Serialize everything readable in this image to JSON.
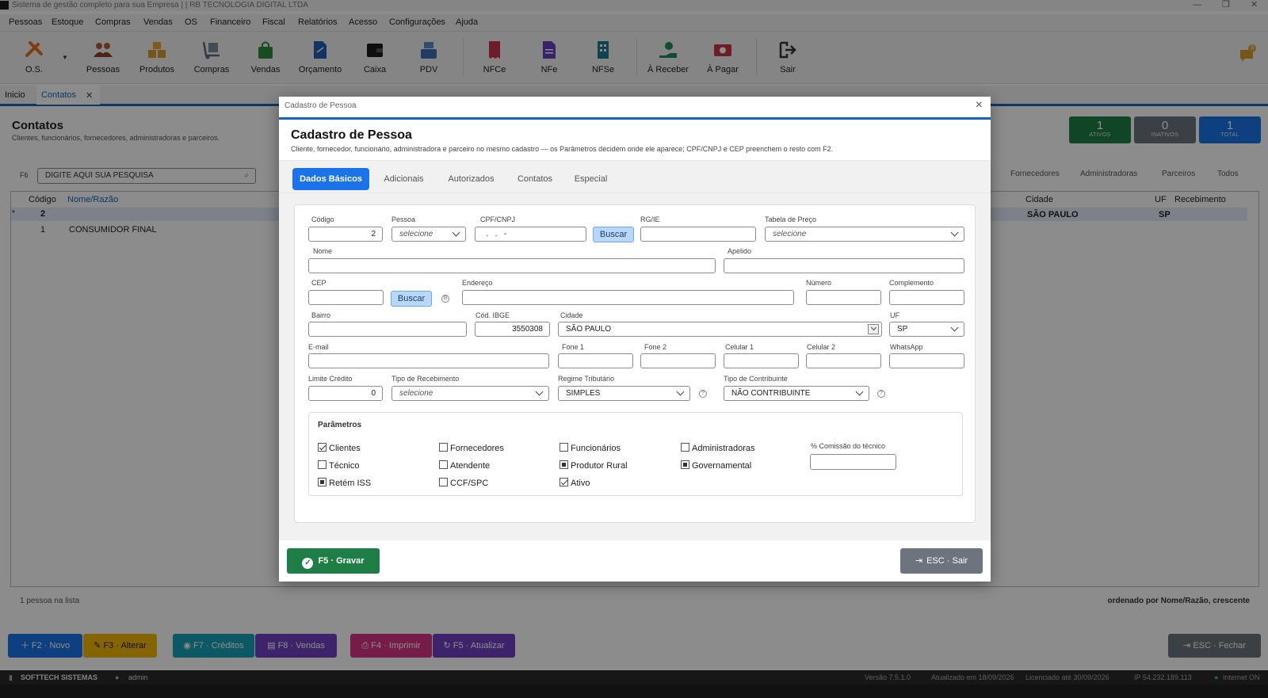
{
  "window": {
    "title": "Sistema de gestão completo para sua Empresa | | RB TECNOLOGIA DIGITAL LTDA"
  },
  "menu": [
    "Pessoas",
    "Estoque",
    "Compras",
    "Vendas",
    "OS",
    "Financeiro",
    "Fiscal",
    "Relatórios",
    "Acesso",
    "Configurações",
    "Ajuda"
  ],
  "toolbar": {
    "os": "O.S.",
    "pessoas": "Pessoas",
    "produtos": "Produtos",
    "compras": "Compras",
    "vendas": "Vendas",
    "orcamento": "Orçamento",
    "caixa": "Caixa",
    "pdv": "PDV",
    "nfce": "NFCe",
    "nfe": "NFe",
    "nfse": "NFSe",
    "areceber": "À Receber",
    "apagar": "À Pagar",
    "sair": "Sair",
    "notif_count": "3"
  },
  "tabs": {
    "inicio": "Inicio",
    "contatos": "Contatos"
  },
  "page": {
    "title": "Contatos",
    "subtitle": "Clientes, funcionários, fornecedores, administradoras e parceiros.",
    "search_key": "F6",
    "search_placeholder": "DIGITE AQUI SUA PESQUISA",
    "stats": [
      {
        "n": "1",
        "l": "ATIVOS"
      },
      {
        "n": "0",
        "l": "INATIVOS"
      },
      {
        "n": "1",
        "l": "TOTAL"
      }
    ],
    "filters": [
      "Fornecedores",
      "Administradoras",
      "Parceiros",
      "Todos"
    ],
    "columns": {
      "codigo": "Código",
      "nome": "Nome/Razão",
      "cidade": "Cidade",
      "uf": "UF",
      "recebimento": "Recebimento"
    },
    "rows": [
      {
        "marker": "*",
        "codigo": "2",
        "nome": "",
        "cidade": "SÃO PAULO",
        "uf": "SP"
      },
      {
        "marker": "",
        "codigo": "1",
        "nome": "CONSUMIDOR FINAL",
        "cidade": "",
        "uf": ""
      }
    ],
    "count": "1 pessoa na lista",
    "order": "ordenado por Nome/Razão, crescente"
  },
  "footer_buttons": {
    "novo": "F2 · Novo",
    "alterar": "F3 · Alterar",
    "creditos": "F7 · Créditos",
    "vendas": "F8 · Vendas",
    "imprimir": "F4 · Imprimir",
    "atualizar": "F5 · Atualizar",
    "fechar": "ESC · Fechar"
  },
  "statusbar": {
    "company": "SOFTTECH SISTEMAS",
    "user": "admin",
    "versao": "Versão  7.5.1.0",
    "atualizado": "Atualizado em 18/09/2026",
    "licenciado": "Licenciado até  30/09/2026",
    "ip": "IP  54.232.189.113",
    "internet": "Internet ON"
  },
  "modal": {
    "window_title": "Cadastro de Pessoa",
    "title": "Cadastro de Pessoa",
    "subtitle": "Cliente, fornecedor, funcionário, administradora e parceiro no mesmo cadastro — os Parâmetros decidem onde ele aparece; CPF/CNPJ e CEP preenchem o resto com F2.",
    "tabs": [
      "Dados Básicos",
      "Adicionais",
      "Autorizados",
      "Contatos",
      "Especial"
    ],
    "fields": {
      "codigo": {
        "label": "Código",
        "value": "2"
      },
      "pessoa": {
        "label": "Pessoa",
        "value": "selecione"
      },
      "cpf": {
        "label": "CPF/CNPJ",
        "value": "  .   .   -"
      },
      "buscar": "Buscar",
      "rg": {
        "label": "RG/IE",
        "value": ""
      },
      "tabela": {
        "label": "Tabela de Preço",
        "value": "selecione"
      },
      "nome": {
        "label": "Nome",
        "value": ""
      },
      "apelido": {
        "label": "Apelido",
        "value": ""
      },
      "cep": {
        "label": "CEP",
        "value": ""
      },
      "endereco": {
        "label": "Endereço",
        "value": ""
      },
      "numero": {
        "label": "Número",
        "value": ""
      },
      "complemento": {
        "label": "Complemento",
        "value": ""
      },
      "bairro": {
        "label": "Bairro",
        "value": ""
      },
      "ibge": {
        "label": "Cód. IBGE",
        "value": "3550308"
      },
      "cidade": {
        "label": "Cidade",
        "value": "SÃO PAULO"
      },
      "uf": {
        "label": "UF",
        "value": "SP"
      },
      "email": {
        "label": "E-mail",
        "value": ""
      },
      "fone1": {
        "label": "Fone 1",
        "value": ""
      },
      "fone2": {
        "label": "Fone 2",
        "value": ""
      },
      "celular1": {
        "label": "Celular 1",
        "value": ""
      },
      "celular2": {
        "label": "Celular 2",
        "value": ""
      },
      "whatsapp": {
        "label": "WhatsApp",
        "value": ""
      },
      "limite": {
        "label": "Limite Crédito",
        "value": "0"
      },
      "tipo_receb": {
        "label": "Tipo de Recebimento",
        "value": "selecione"
      },
      "regime": {
        "label": "Regime Tributário",
        "value": "SIMPLES"
      },
      "contribuinte": {
        "label": "Tipo de Contribuinte",
        "value": "NÃO CONTRIBUINTE"
      }
    },
    "params": {
      "title": "Parâmetros",
      "items": [
        {
          "label": "Clientes",
          "state": "checked"
        },
        {
          "label": "Fornecedores",
          "state": "unchecked"
        },
        {
          "label": "Funcionários",
          "state": "unchecked"
        },
        {
          "label": "Administradoras",
          "state": "unchecked"
        },
        {
          "label": "Técnico",
          "state": "unchecked"
        },
        {
          "label": "Atendente",
          "state": "unchecked"
        },
        {
          "label": "Produtor Rural",
          "state": "indeterminate"
        },
        {
          "label": "Governamental",
          "state": "indeterminate"
        },
        {
          "label": "Retém ISS",
          "state": "indeterminate"
        },
        {
          "label": "CCF/SPC",
          "state": "unchecked"
        },
        {
          "label": "Ativo",
          "state": "checked"
        }
      ],
      "comissao": {
        "label": "% Comissão do técnico",
        "value": ""
      }
    },
    "gravar": "F5 · Gravar",
    "sair": "ESC · Sair"
  }
}
